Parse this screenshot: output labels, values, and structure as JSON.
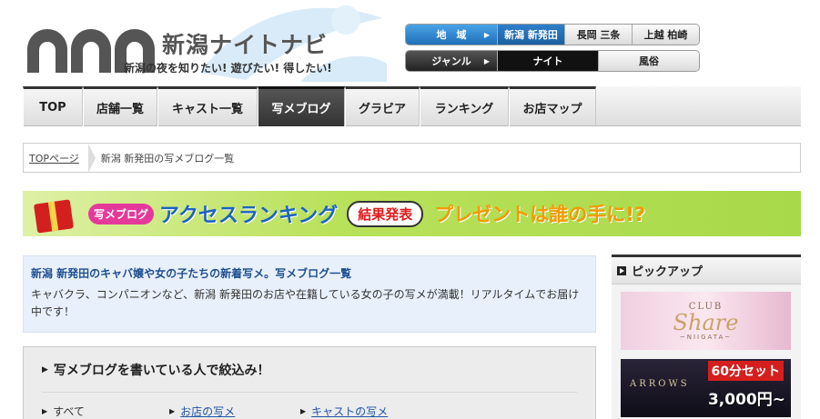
{
  "header": {
    "logo_title": "新潟ナイトナビ",
    "tagline": "新潟の夜を知りたい! 遊びたい! 得したい!"
  },
  "region_selector": {
    "label": "地　域",
    "options": [
      "新潟 新発田",
      "長岡 三条",
      "上越 柏崎"
    ],
    "active_index": 0
  },
  "genre_selector": {
    "label": "ジャンル",
    "options": [
      "ナイト",
      "風俗"
    ],
    "active_index": 0
  },
  "nav": {
    "items": [
      "TOP",
      "店舗一覧",
      "キャスト一覧",
      "写メブログ",
      "グラビア",
      "ランキング",
      "お店マップ"
    ],
    "active_index": 3
  },
  "breadcrumb": {
    "home": "TOPページ",
    "current": "新潟 新発田の写メブログ一覧"
  },
  "banner": {
    "badge": "写メブログ",
    "main": "アクセスランキング",
    "result": "結果発表",
    "sub": "プレゼントは誰の手に!?"
  },
  "intro": {
    "title": "新潟 新発田のキャバ嬢や女の子たちの新着写メ。写メブログ一覧",
    "text": "キャバクラ、コンパニオンなど、新潟 新発田のお店や在籍している女の子の写メが満載！リアルタイムでお届け中です！"
  },
  "filter": {
    "title": "写メブログを書いている人で絞込み！",
    "options": {
      "all": "すべて",
      "shop": "お店の写メ",
      "cast": "キャストの写メ"
    }
  },
  "sidebar": {
    "pickup_title": "ピックアップ",
    "share": {
      "club": "CLUB",
      "name": "Share",
      "sub": "~NIIGATA~"
    },
    "arrows": {
      "brand": "ARROWS",
      "set": "60分セット",
      "price": "3,000円~"
    }
  },
  "colors": {
    "accent_blue": "#1f6fb8",
    "nav_active": "#333333",
    "link": "#2055a8",
    "intro_bg": "#e8f0fb",
    "banner_green": "#b9e15a"
  }
}
